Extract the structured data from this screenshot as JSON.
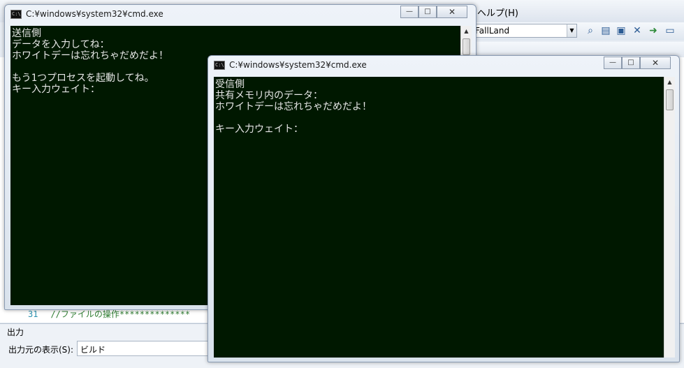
{
  "ide": {
    "menu_help": "ヘルプ(H)",
    "project_combo": "FallLand",
    "code_line_number": "31",
    "code_line_text": "//ファイルの操作**************",
    "output_panel_title": "出力",
    "output_source_label": "出力元の表示(S):",
    "output_source_value": "ビルド",
    "toolbar_icons": [
      "find-icon",
      "properties-icon",
      "object-browser-icon",
      "tools-icon",
      "start-icon",
      "window-icon"
    ]
  },
  "sender_window": {
    "title": "C:¥windows¥system32¥cmd.exe",
    "icon_label": "C:\\",
    "controls": {
      "minimize": "—",
      "maximize": "□",
      "close": "✕"
    },
    "lines": [
      "送信側",
      "データを入力してね：",
      "ホワイトデーは忘れちゃだめだよ！",
      "",
      "もう1つプロセスを起動してね。",
      "キー入力ウェイト："
    ]
  },
  "receiver_window": {
    "title": "C:¥windows¥system32¥cmd.exe",
    "icon_label": "C:\\",
    "controls": {
      "minimize": "—",
      "maximize": "□",
      "close": "✕"
    },
    "lines": [
      "受信側",
      "共有メモリ内のデータ：",
      "ホワイトデーは忘れちゃだめだよ！",
      "",
      "キー入力ウェイト："
    ]
  },
  "scroll_arrows": {
    "up": "▲",
    "down": "▼"
  }
}
